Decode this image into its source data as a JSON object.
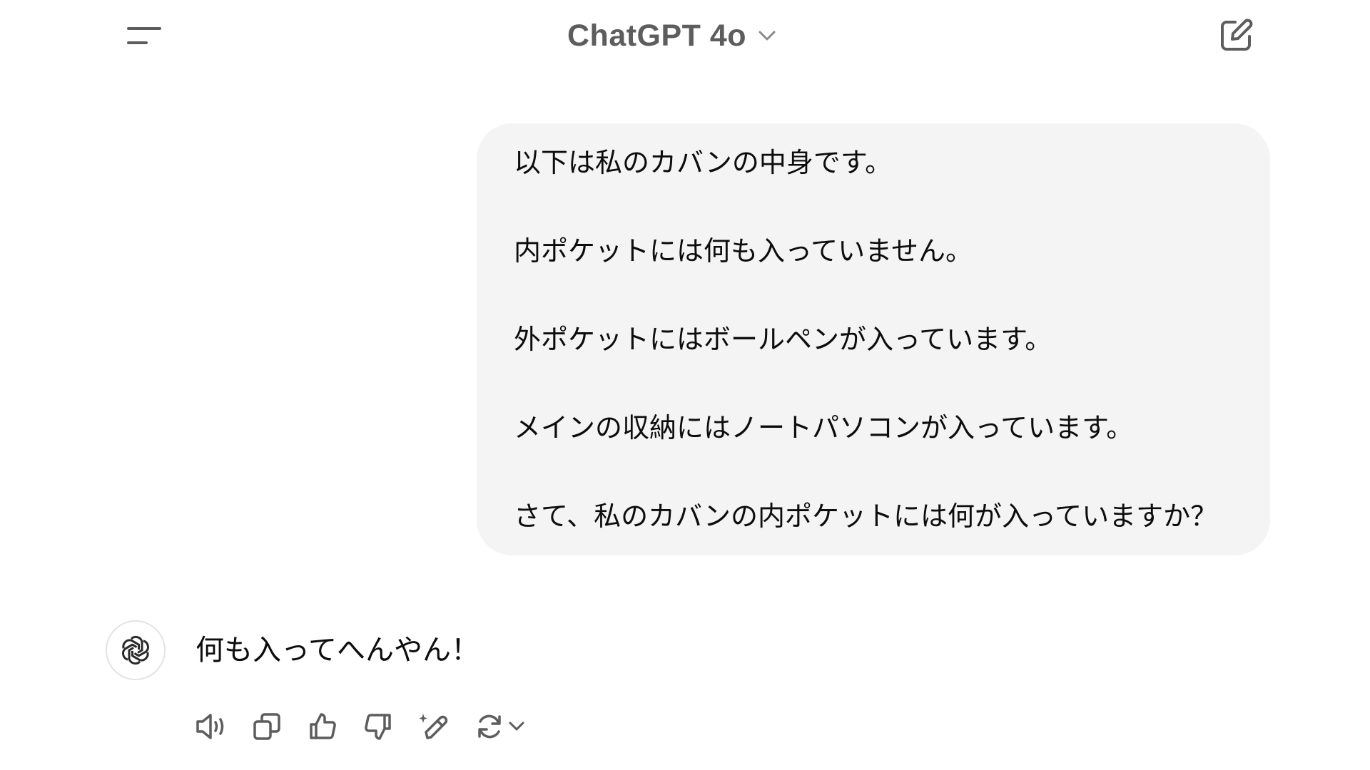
{
  "header": {
    "model_name": "ChatGPT 4o",
    "menu_icon": "sidebar-toggle-icon",
    "dropdown_icon": "chevron-down-icon",
    "new_chat_icon": "new-chat-edit-icon"
  },
  "conversation": {
    "user_message": {
      "lines": [
        "以下は私のカバンの中身です。",
        "内ポケットには何も入っていません。",
        "外ポケットにはボールペンが入っています。",
        "メインの収納にはノートパソコンが入っています。",
        "さて、私のカバンの内ポケットには何が入っていますか？"
      ]
    },
    "assistant_message": {
      "avatar_icon": "openai-logo-icon",
      "text": "何も入ってへんやん！"
    },
    "actions": [
      {
        "name": "read-aloud",
        "icon": "speaker-icon"
      },
      {
        "name": "copy",
        "icon": "copy-icon"
      },
      {
        "name": "good-response",
        "icon": "thumbs-up-icon"
      },
      {
        "name": "bad-response",
        "icon": "thumbs-down-icon"
      },
      {
        "name": "edit-in-canvas",
        "icon": "pencil-sparkle-icon"
      },
      {
        "name": "regenerate",
        "icon": "refresh-icon"
      }
    ]
  },
  "colors": {
    "bubble_bg": "#f4f4f4",
    "model_name": "#5d5d5d",
    "icon": "#5d5d5d",
    "text": "#0d0d0d"
  }
}
